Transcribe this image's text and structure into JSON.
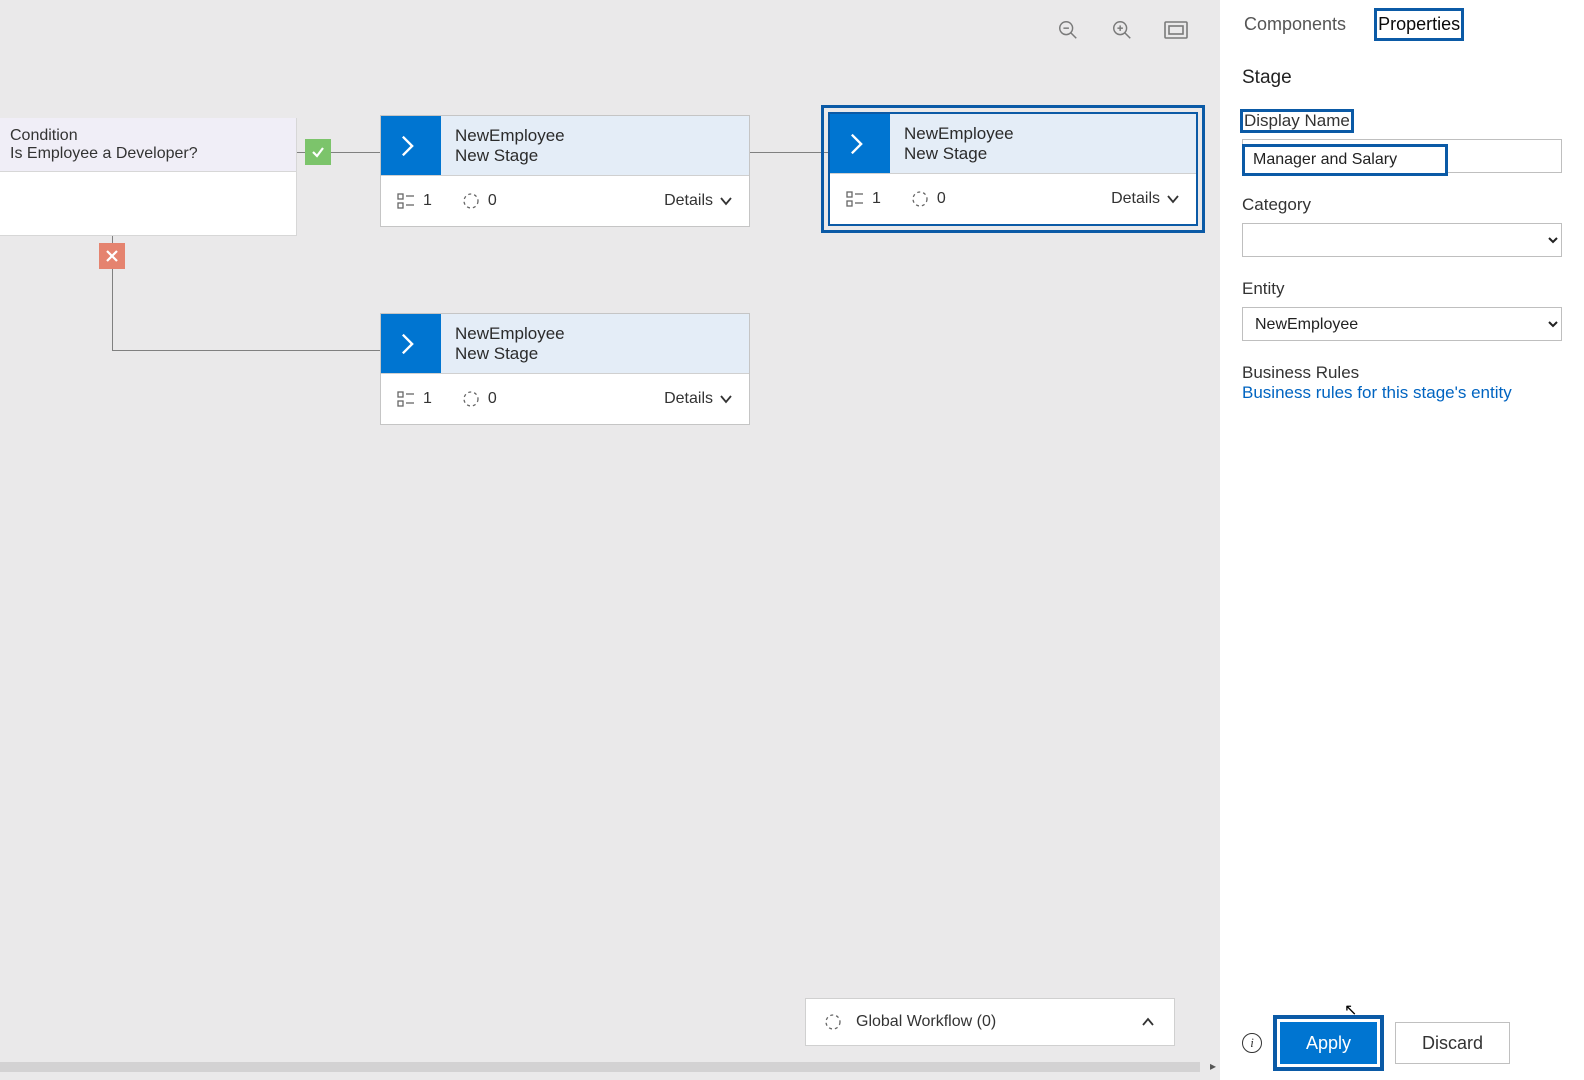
{
  "toolbar": {
    "zoom_out_icon": "zoom-out",
    "zoom_in_icon": "zoom-in",
    "fit_icon": "fit-to-screen"
  },
  "condition": {
    "label": "Condition",
    "text": "Is Employee a Developer?"
  },
  "stages": {
    "s1": {
      "entity": "NewEmployee",
      "name": "New Stage",
      "steps": "1",
      "workflows": "0",
      "details": "Details"
    },
    "s2": {
      "entity": "NewEmployee",
      "name": "New Stage",
      "steps": "1",
      "workflows": "0",
      "details": "Details",
      "selected": true
    },
    "s3": {
      "entity": "NewEmployee",
      "name": "New Stage",
      "steps": "1",
      "workflows": "0",
      "details": "Details"
    }
  },
  "global_workflow": {
    "label": "Global Workflow (0)"
  },
  "panel": {
    "tabs": {
      "components": "Components",
      "properties": "Properties"
    },
    "section": "Stage",
    "display_name_label": "Display Name",
    "display_name_value": "Manager and Salary",
    "category_label": "Category",
    "category_value": "",
    "entity_label": "Entity",
    "entity_value": "NewEmployee",
    "business_rules_label": "Business Rules",
    "business_rules_link": "Business rules for this stage's entity",
    "apply": "Apply",
    "discard": "Discard"
  }
}
